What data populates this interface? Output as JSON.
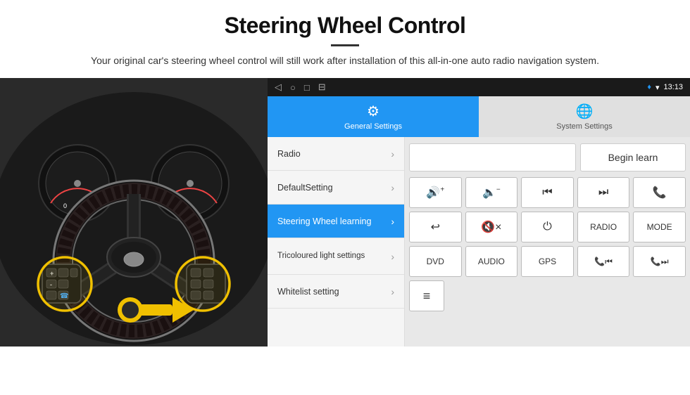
{
  "header": {
    "title": "Steering Wheel Control",
    "subtitle": "Your original car's steering wheel control will still work after installation of this all-in-one auto radio navigation system.",
    "divider": true
  },
  "statusBar": {
    "nav_back": "◁",
    "nav_home": "○",
    "nav_square": "□",
    "nav_extra": "⊟",
    "location_icon": "♦",
    "signal_icon": "▾",
    "time": "13:13"
  },
  "tabs": [
    {
      "id": "general",
      "label": "General Settings",
      "icon": "⚙",
      "active": true
    },
    {
      "id": "system",
      "label": "System Settings",
      "icon": "🌐",
      "active": false
    }
  ],
  "menu": {
    "items": [
      {
        "id": "radio",
        "label": "Radio",
        "active": false
      },
      {
        "id": "default",
        "label": "DefaultSetting",
        "active": false
      },
      {
        "id": "steering",
        "label": "Steering Wheel learning",
        "active": true
      },
      {
        "id": "tricoloured",
        "label": "Tricoloured light settings",
        "active": false
      },
      {
        "id": "whitelist",
        "label": "Whitelist setting",
        "active": false
      }
    ]
  },
  "controls": {
    "begin_learn_label": "Begin learn",
    "rows": [
      [
        {
          "id": "vol_up",
          "label": "🔊+",
          "type": "symbol"
        },
        {
          "id": "vol_down",
          "label": "🔈-",
          "type": "symbol"
        },
        {
          "id": "prev_track",
          "label": "⏮",
          "type": "symbol"
        },
        {
          "id": "next_track",
          "label": "⏭",
          "type": "symbol"
        },
        {
          "id": "phone",
          "label": "📞",
          "type": "symbol"
        }
      ],
      [
        {
          "id": "hang_up",
          "label": "↩",
          "type": "symbol"
        },
        {
          "id": "mute",
          "label": "🔇×",
          "type": "symbol"
        },
        {
          "id": "power",
          "label": "⏻",
          "type": "symbol"
        },
        {
          "id": "radio_btn",
          "label": "RADIO",
          "type": "text"
        },
        {
          "id": "mode_btn",
          "label": "MODE",
          "type": "text"
        }
      ],
      [
        {
          "id": "dvd_btn",
          "label": "DVD",
          "type": "text"
        },
        {
          "id": "audio_btn",
          "label": "AUDIO",
          "type": "text"
        },
        {
          "id": "gps_btn",
          "label": "GPS",
          "type": "text"
        },
        {
          "id": "phone_prev",
          "label": "📞⏮",
          "type": "symbol"
        },
        {
          "id": "phone_next",
          "label": "📞⏭",
          "type": "symbol"
        }
      ]
    ],
    "bottom_icon": "≡"
  }
}
